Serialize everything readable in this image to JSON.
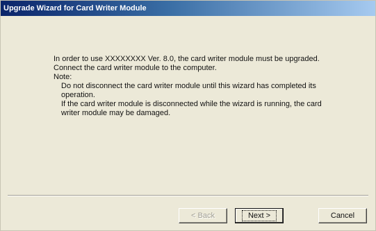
{
  "window": {
    "title": "Upgrade Wizard for Card Writer Module"
  },
  "message": {
    "intro": "In order to use XXXXXXXX Ver. 8.0, the card writer module must be upgraded.",
    "connect": "Connect the card writer module to the computer.",
    "note_label": "Note:",
    "warning_1": "Do not disconnect the card writer module until this wizard has completed its operation.",
    "warning_2": "If the card writer module is disconnected while the wizard is running, the card writer module may be damaged."
  },
  "buttons": {
    "back": "< Back",
    "next": "Next >",
    "cancel": "Cancel"
  }
}
